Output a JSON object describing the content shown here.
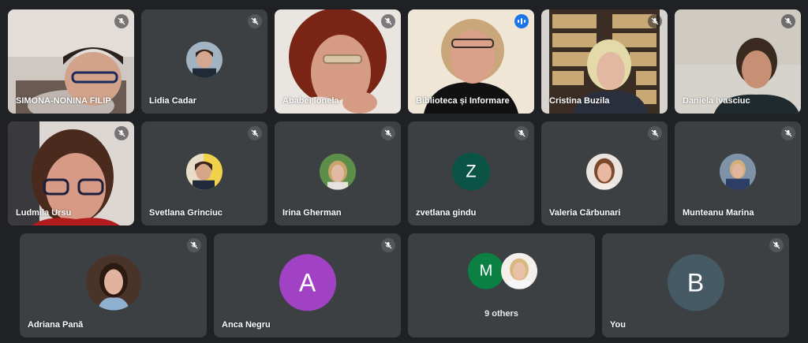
{
  "participants": [
    {
      "name": "SIMONA-NONINA FILIP",
      "muted": true
    },
    {
      "name": "Lidia Cadar",
      "muted": true
    },
    {
      "name": "Ababei Ionela",
      "muted": true
    },
    {
      "name": "Biblioteca și Informare",
      "muted": false,
      "speaking": true
    },
    {
      "name": "Cristina Buzila",
      "muted": true
    },
    {
      "name": "Daniela Ivasciuc",
      "muted": true
    },
    {
      "name": "Ludmila Ursu",
      "muted": true
    },
    {
      "name": "Svetlana Grinciuc",
      "muted": true
    },
    {
      "name": "Irina Gherman",
      "muted": true
    },
    {
      "name": "zvetlana gindu",
      "muted": true,
      "initial": "Z",
      "avatar_color": "#0b5345"
    },
    {
      "name": "Valeria Cărbunari",
      "muted": true
    },
    {
      "name": "Munteanu Marina",
      "muted": true
    },
    {
      "name": "Adriana Pană",
      "muted": true
    },
    {
      "name": "Anca Negru",
      "muted": true,
      "initial": "A",
      "avatar_color": "#a142c4"
    },
    {
      "name": "You",
      "muted": true,
      "initial": "B",
      "avatar_color": "#455a64"
    }
  ],
  "others": {
    "label": "9 others",
    "initial": "M",
    "avatar_color": "#0b8043"
  },
  "icons": {
    "muted": "mic-off-icon",
    "speaking": "speaking-indicator-icon"
  }
}
